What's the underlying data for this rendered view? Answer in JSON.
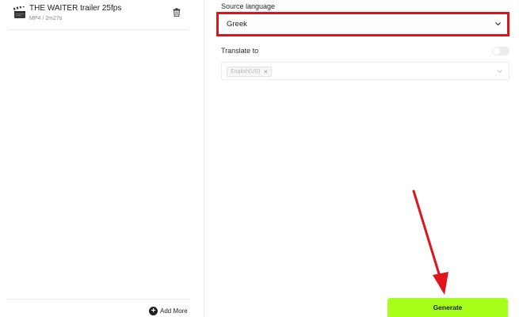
{
  "file_list": {
    "items": [
      {
        "name": "THE WAITER trailer 25fps",
        "meta": "MP4 / 2m27s",
        "icon": "clapperboard-icon"
      }
    ],
    "add_more_label": "Add More"
  },
  "form": {
    "source_language": {
      "label": "Source language",
      "value": "Greek"
    },
    "translate_to": {
      "label": "Translate to",
      "enabled": false,
      "selected": [
        {
          "label": "English(US)"
        }
      ]
    },
    "generate_label": "Generate"
  },
  "colors": {
    "accent_green": "#a7ff1a",
    "highlight_red": "#e0141b",
    "border": "#ececec"
  }
}
